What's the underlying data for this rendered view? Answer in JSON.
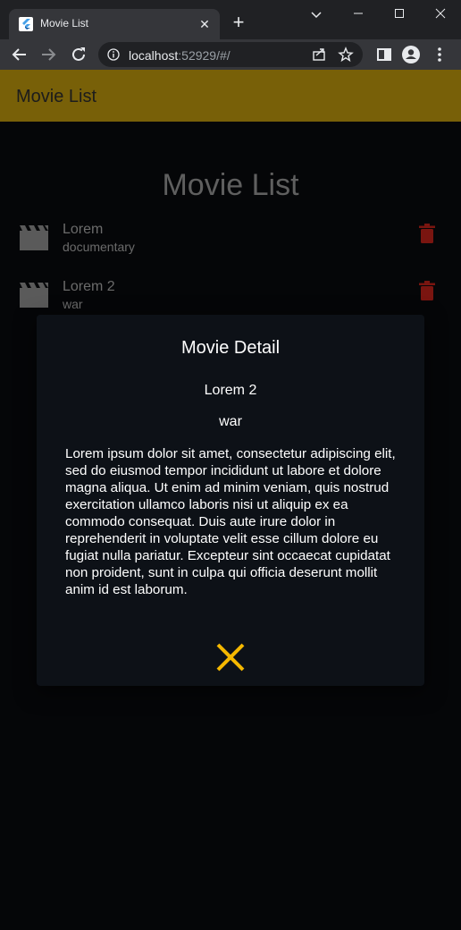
{
  "browser": {
    "tab_title": "Movie List",
    "url_host": "localhost",
    "url_rest": ":52929/#/"
  },
  "app": {
    "appbar_title": "Movie List",
    "heading": "Movie List",
    "accent_color": "#786008",
    "movies": [
      {
        "title": "Lorem",
        "genre": "documentary"
      },
      {
        "title": "Lorem 2",
        "genre": "war"
      }
    ]
  },
  "dialog": {
    "title": "Movie Detail",
    "movie_title": "Lorem 2",
    "genre": "war",
    "description": "Lorem ipsum dolor sit amet, consectetur adipiscing elit, sed do eiusmod tempor incididunt ut labore et dolore magna aliqua. Ut enim ad minim veniam, quis nostrud exercitation ullamco laboris nisi ut aliquip ex ea commodo consequat. Duis aute irure dolor in reprehenderit in voluptate velit esse cillum dolore eu fugiat nulla pariatur. Excepteur sint occaecat cupidatat non proident, sunt in culpa qui officia deserunt mollit anim id est laborum.",
    "close_icon": "close-icon",
    "close_color": "#f5b800"
  }
}
